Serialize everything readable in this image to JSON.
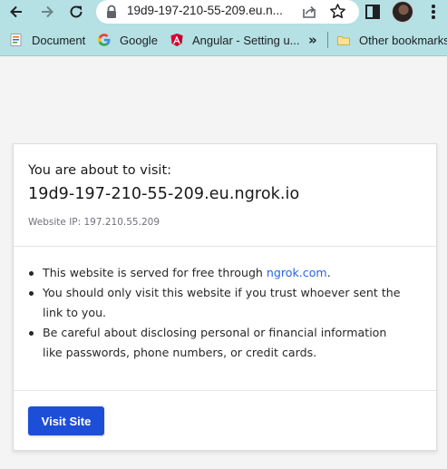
{
  "browser": {
    "address_bar": {
      "url": "19d9-197-210-55-209.eu.n..."
    },
    "bookmarks": [
      {
        "label": "Document",
        "icon": "document-icon"
      },
      {
        "label": "Google",
        "icon": "google-icon"
      },
      {
        "label": "Angular - Setting u...",
        "icon": "angular-icon"
      }
    ],
    "overflow_label": "»",
    "other_bookmarks": {
      "label": "Other bookmarks",
      "icon": "folder-icon"
    },
    "colors": {
      "chrome_bg": "#b5e0e4"
    }
  },
  "page": {
    "visit_label": "You are about to visit:",
    "host": "19d9-197-210-55-209.eu.ngrok.io",
    "website_ip": "Website IP: 197.210.55.209",
    "bullets": {
      "b1_prefix": "This website is served for free through ",
      "b1_link": "ngrok.com",
      "b1_suffix": ".",
      "b2": "You should only visit this website if you trust whoever sent the link to you.",
      "b3": "Be careful about disclosing personal or financial information like passwords, phone numbers, or credit cards."
    },
    "visit_button": "Visit Site",
    "colors": {
      "button_bg": "#1d4ed8",
      "link": "#2563eb"
    }
  }
}
